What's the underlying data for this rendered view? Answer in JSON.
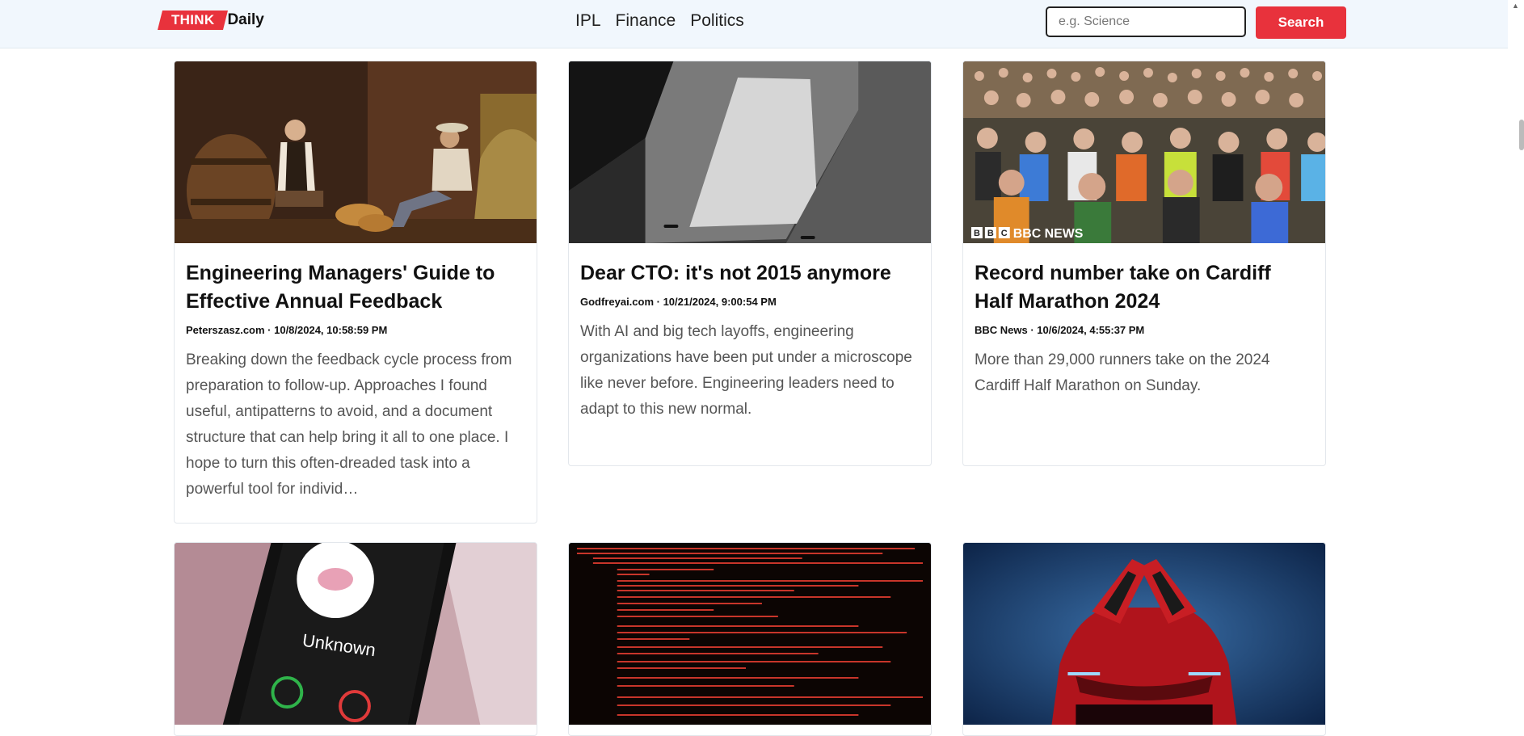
{
  "navbar": {
    "logo_think": "THINK",
    "logo_daily": "Daily",
    "links": [
      "IPL",
      "Finance",
      "Politics"
    ],
    "search_placeholder": "e.g. Science",
    "search_label": "Search"
  },
  "cards": [
    {
      "title": "Engineering Managers' Guide to Effective Annual Feedback",
      "meta": "Peterszasz.com · 10/8/2024, 10:58:59 PM",
      "description": "Breaking down the feedback cycle process from preparation to follow-up. Approaches I found useful, antipatterns to avoid, and a document structure that can help bring it all to one place. I hope to turn this often-dreaded task into a powerful tool for individ…"
    },
    {
      "title": "Dear CTO: it's not 2015 anymore",
      "meta": "Godfreyai.com · 10/21/2024, 9:00:54 PM",
      "description": "With AI and big tech layoffs, engineering organizations have been put under a microscope like never before. Engineering leaders need to adapt to this new normal."
    },
    {
      "title": "Record number take on Cardiff Half Marathon 2024",
      "meta": "BBC News · 10/6/2024, 4:55:37 PM",
      "description": "More than 29,000 runners take on the 2024 Cardiff Half Marathon on Sunday.",
      "image_watermark": "BBC NEWS"
    },
    {
      "image_text": "Unknown"
    },
    {
      "image_text": ""
    },
    {
      "image_text": ""
    }
  ]
}
